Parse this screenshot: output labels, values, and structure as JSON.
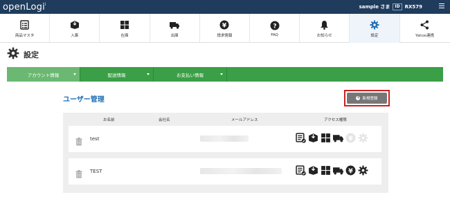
{
  "header": {
    "logo": "openLogi",
    "user_name": "sample さま",
    "id_label": "ID",
    "id_value": "RX579"
  },
  "nav": {
    "items": [
      {
        "label": "商品マスタ",
        "icon": "list-icon"
      },
      {
        "label": "入庫",
        "icon": "box-in-icon"
      },
      {
        "label": "在庫",
        "icon": "boxes-icon"
      },
      {
        "label": "出庫",
        "icon": "truck-icon"
      },
      {
        "label": "請求情報",
        "icon": "yen-icon"
      },
      {
        "label": "FAQ",
        "icon": "question-icon"
      },
      {
        "label": "お知らせ",
        "icon": "bell-icon"
      },
      {
        "label": "設定",
        "icon": "gear-icon",
        "active": true
      },
      {
        "label": "Yahoo連携",
        "icon": "share-icon"
      }
    ]
  },
  "page": {
    "title": "設定"
  },
  "tabs": [
    {
      "label": "アカウント情報"
    },
    {
      "label": "配送情報"
    },
    {
      "label": "お支払い情報"
    }
  ],
  "section": {
    "title": "ユーザー管理",
    "new_button": "新規登録"
  },
  "table": {
    "headers": {
      "name": "お名前",
      "company": "会社名",
      "email": "メールアドレス",
      "access": "アクセス権限"
    },
    "rows": [
      {
        "name": "test",
        "company": "",
        "permissions": {
          "product": true,
          "inbound": true,
          "stock": true,
          "outbound": true,
          "billing": false,
          "settings": false
        }
      },
      {
        "name": "TEST",
        "company": "",
        "permissions": {
          "product": true,
          "inbound": true,
          "stock": true,
          "outbound": true,
          "billing": true,
          "settings": true
        }
      }
    ]
  },
  "colors": {
    "header_bg": "#1f3c5c",
    "tab_bar": "#3a9f46",
    "section_title": "#1f6fb5",
    "highlight_border": "#c8201e"
  }
}
